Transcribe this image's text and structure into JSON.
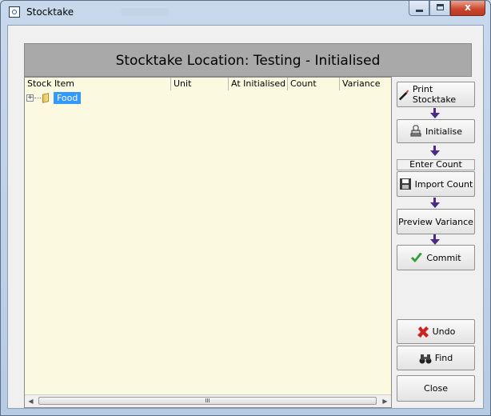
{
  "window": {
    "title": "Stocktake"
  },
  "header": {
    "title": "Stocktake Location: Testing - Initialised"
  },
  "grid": {
    "columns": [
      "Stock Item",
      "Unit",
      "At Initialised",
      "Count",
      "Variance"
    ],
    "rows": [
      {
        "label": "Food",
        "expander": "+",
        "selected": true
      }
    ],
    "scroll_thumb_glyph": "III"
  },
  "actions": {
    "print_stocktake": "Print Stocktake",
    "initialise": "Initialise",
    "enter_count_label": "Enter Count",
    "import_count": "Import Count",
    "preview_variance": "Preview Variance",
    "commit": "Commit",
    "undo": "Undo",
    "find": "Find",
    "close": "Close"
  },
  "colors": {
    "grid_bg": "#fbfae0",
    "header_band": "#a9a9a9",
    "selection": "#3399ff",
    "flow_arrow": "#4a2a8a"
  }
}
